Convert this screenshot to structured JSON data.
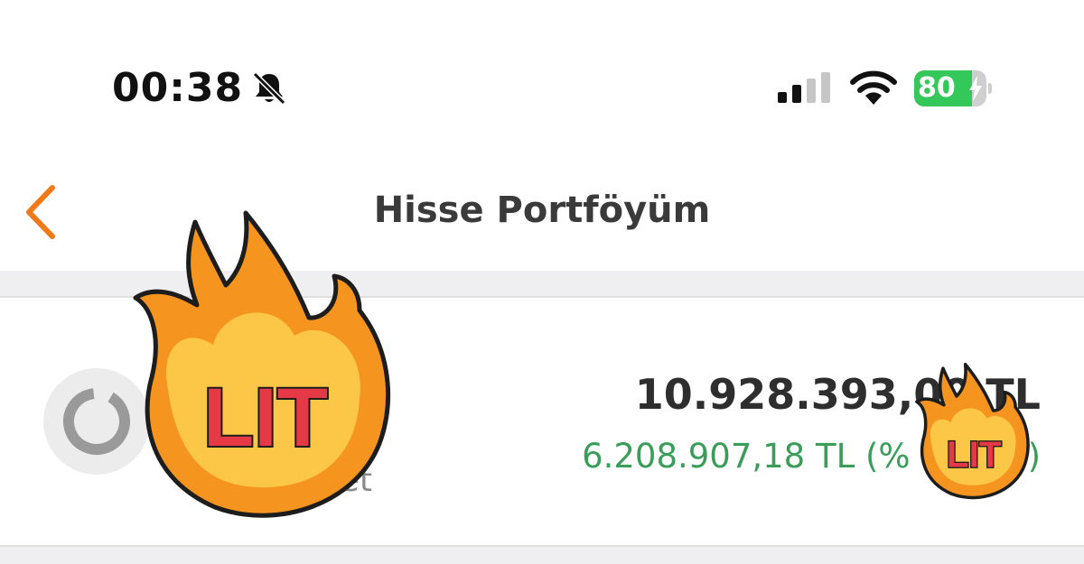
{
  "status_bar": {
    "time": "00:38",
    "battery_percent": 80,
    "battery_label": "80",
    "signal_bars_active": 2,
    "signal_bars_total": 4,
    "icons": [
      "bell-slash-icon",
      "signal-icon",
      "wifi-icon",
      "battery-charging-icon"
    ]
  },
  "nav": {
    "title": "Hisse Portföyüm",
    "back_icon": "chevron-left-icon"
  },
  "portfolio": {
    "quantity_label_partial": "udet",
    "total_value": "10.928.393,00 TL",
    "gain_value": "6.208.907,18 TL (%",
    "gain_suffix": ")"
  },
  "stickers": {
    "large_text": "LIT",
    "small_text": "LIT"
  },
  "colors": {
    "accent": "#f07a1a",
    "gain": "#3a9d59",
    "battery": "#34c759",
    "flame_outer": "#f5951f",
    "flame_inner": "#fcc647",
    "lit_text": "#e53946"
  }
}
